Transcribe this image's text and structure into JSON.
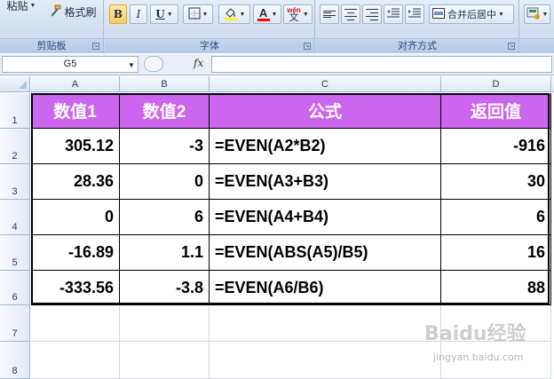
{
  "ribbon": {
    "clipboard": {
      "paste_label": "粘贴",
      "format_painter_label": "格式刷",
      "group_label": "剪贴板"
    },
    "font": {
      "bold_label": "B",
      "italic_label": "I",
      "underline_label": "U",
      "font_color_label": "A",
      "phonetic_top": "wén",
      "phonetic_bottom": "文",
      "group_label": "字体"
    },
    "alignment": {
      "merge_center_label": "合并后居中",
      "group_label": "对齐方式"
    }
  },
  "formula_bar": {
    "name_box": "G5",
    "fx_label": "fx",
    "formula": ""
  },
  "sheet": {
    "columns": [
      "A",
      "B",
      "C",
      "D"
    ],
    "rows": [
      "1",
      "2",
      "3",
      "4",
      "5",
      "6",
      "7",
      "8"
    ],
    "header": [
      "数值1",
      "数值2",
      "公式",
      "返回值"
    ],
    "data": [
      [
        "305.12",
        "-3",
        "=EVEN(A2*B2)",
        "-916"
      ],
      [
        "28.36",
        "0",
        "=EVEN(A3+B3)",
        "30"
      ],
      [
        "0",
        "6",
        "=EVEN(A4+B4)",
        "6"
      ],
      [
        "-16.89",
        "1.1",
        "=EVEN(ABS(A5)/B5)",
        "16"
      ],
      [
        "-333.56",
        "-3.8",
        "=EVEN(A6/B6)",
        "88"
      ]
    ],
    "header_bg": "#cc66ee"
  },
  "watermark": {
    "main": "Baidu经验",
    "sub": "jingyan.baidu.com"
  }
}
